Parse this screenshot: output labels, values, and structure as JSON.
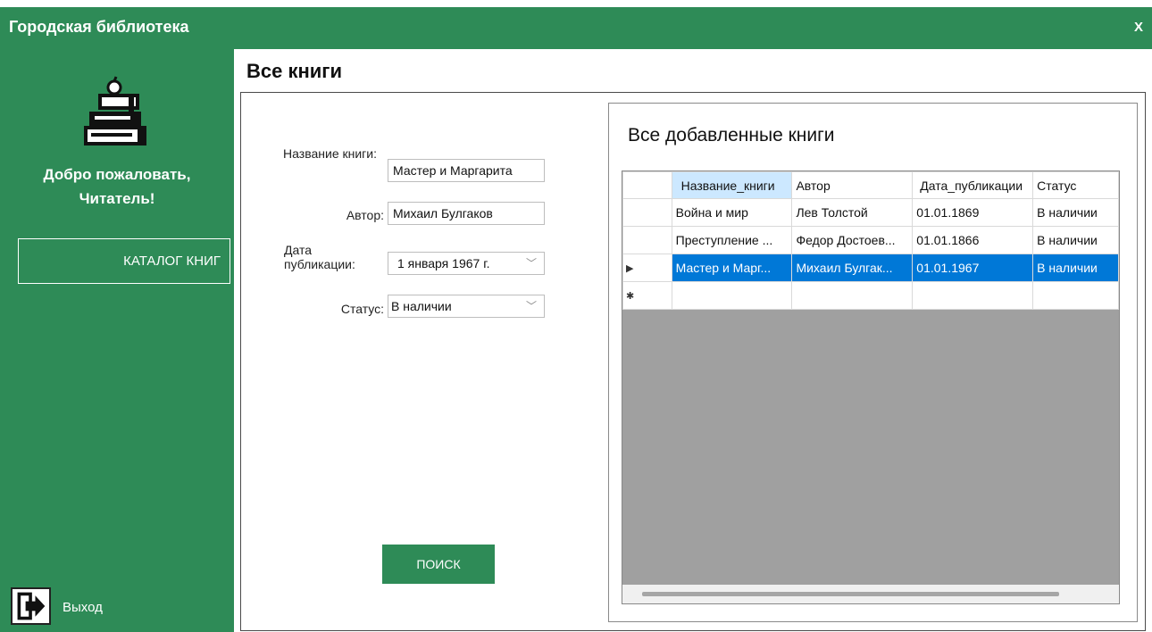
{
  "window": {
    "title": "Городская библиотека",
    "close_label": "X"
  },
  "sidebar": {
    "welcome_line1": "Добро пожаловать,",
    "welcome_line2": "Читатель!",
    "catalog_button": "КАТАЛОГ КНИГ",
    "exit_label": "Выход"
  },
  "main": {
    "page_title": "Все книги",
    "form": {
      "title_label": "Название книги:",
      "title_value": "Мастер и Маргарита",
      "author_label": "Автор:",
      "author_value": "Михаил Булгаков",
      "date_label": "Дата публикации:",
      "date_value": "1  января  1967 г.",
      "status_label": "Статус:",
      "status_value": "В наличии",
      "search_button": "ПОИСК"
    },
    "grid": {
      "title": "Все добавленные книги",
      "columns": [
        "Название_книги",
        "Автор",
        "Дата_публикации",
        "Статус"
      ],
      "rows": [
        [
          "Война и мир",
          "Лев Толстой",
          "01.01.1869",
          "В наличии"
        ],
        [
          "Преступление ...",
          "Федор Достоев...",
          "01.01.1866",
          "В наличии"
        ],
        [
          "Мастер и Марг...",
          "Михаил Булгак...",
          "01.01.1967",
          "В наличии"
        ]
      ],
      "selected_row": 2
    }
  }
}
